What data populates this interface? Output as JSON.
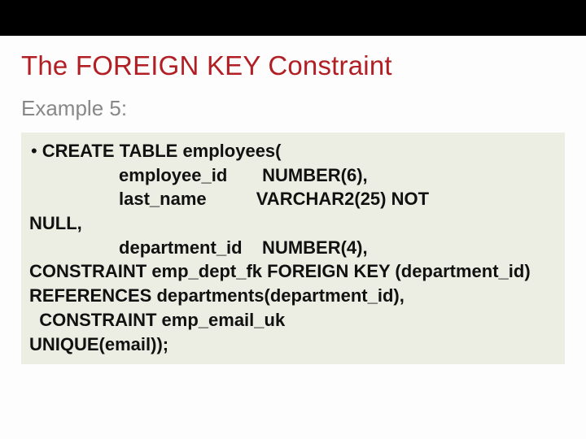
{
  "title": "The FOREIGN KEY Constraint",
  "subtitle": "Example 5:",
  "code": {
    "bullet": "•",
    "l1": "CREATE TABLE employees(",
    "l2": "                  employee_id       NUMBER(6),",
    "l3": "                  last_name          VARCHAR2(25) NOT",
    "l4": "NULL,",
    "l5": "                  department_id    NUMBER(4),",
    "l6": "      CONSTRAINT emp_dept_fk  FOREIGN KEY (department_id)  REFERENCES departments(department_id),",
    "l7": "  CONSTRAINT emp_email_uk",
    "l8": "UNIQUE(email));"
  }
}
